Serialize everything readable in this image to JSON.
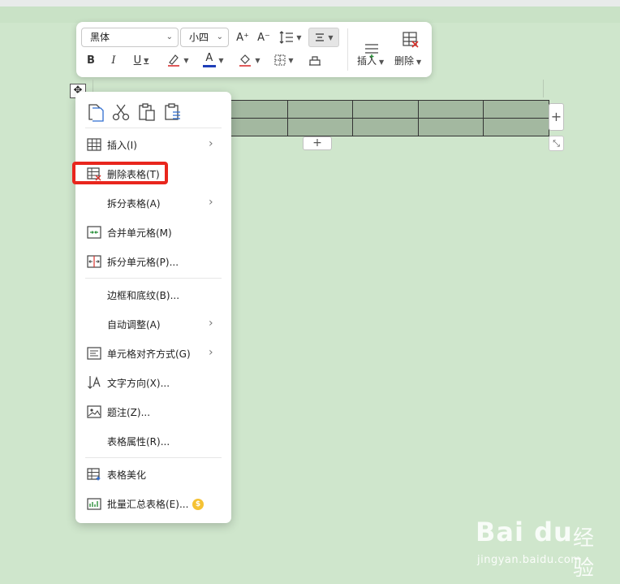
{
  "toolbar": {
    "font_name": "黑体",
    "font_size": "小四",
    "grow_font": "A⁺",
    "shrink_font": "A⁻",
    "bold": "B",
    "italic": "I",
    "underline": "U",
    "font_color_glyph": "A",
    "insert_label": "插入",
    "delete_label": "删除",
    "font_color": "#1f3fb8",
    "highlight_color": "#e05a5a"
  },
  "table_controls": {
    "move_glyph": "✥",
    "add_glyph": "+",
    "resize_glyph": "⤡"
  },
  "menu": {
    "items": [
      {
        "label": "插入(I)",
        "submenu": true,
        "icon": "insert-table-icon"
      },
      {
        "label": "删除表格(T)",
        "submenu": false,
        "icon": "delete-table-icon",
        "highlighted": true
      },
      {
        "label": "拆分表格(A)",
        "submenu": true,
        "icon": ""
      },
      {
        "label": "合并单元格(M)",
        "submenu": false,
        "icon": "merge-cells-icon"
      },
      {
        "label": "拆分单元格(P)...",
        "submenu": false,
        "icon": "split-cells-icon"
      },
      {
        "label": "边框和底纹(B)...",
        "submenu": false,
        "icon": ""
      },
      {
        "label": "自动调整(A)",
        "submenu": true,
        "icon": ""
      },
      {
        "label": "单元格对齐方式(G)",
        "submenu": true,
        "icon": "cell-align-icon"
      },
      {
        "label": "文字方向(X)...",
        "submenu": false,
        "icon": "text-direction-icon"
      },
      {
        "label": "题注(Z)...",
        "submenu": false,
        "icon": "caption-icon"
      },
      {
        "label": "表格属性(R)...",
        "submenu": false,
        "icon": ""
      },
      {
        "label": "表格美化",
        "submenu": false,
        "icon": "table-beautify-icon"
      },
      {
        "label": "批量汇总表格(E)...",
        "submenu": false,
        "icon": "batch-summary-icon",
        "vip": true
      }
    ],
    "arrow_glyph": "›",
    "vip_glyph": "$"
  },
  "watermark": {
    "logo": "Bai du",
    "cn": "经验",
    "url": "jingyan.baidu.com"
  }
}
